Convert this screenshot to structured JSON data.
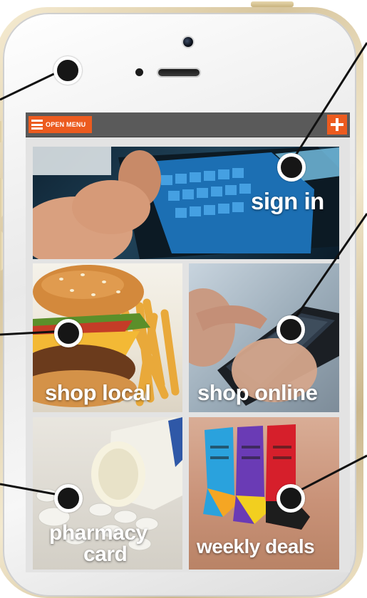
{
  "topbar": {
    "menu_label": "OPEN MENU"
  },
  "tiles": {
    "sign_in": "sign in",
    "shop_local": "shop local",
    "shop_online": "shop online",
    "pharmacy_line1": "pharmacy",
    "pharmacy_line2": "card",
    "weekly_deals": "weekly deals"
  },
  "colors": {
    "accent": "#ec5b1f",
    "topbar": "#5a5a5a",
    "frame": "#d7c59d"
  }
}
